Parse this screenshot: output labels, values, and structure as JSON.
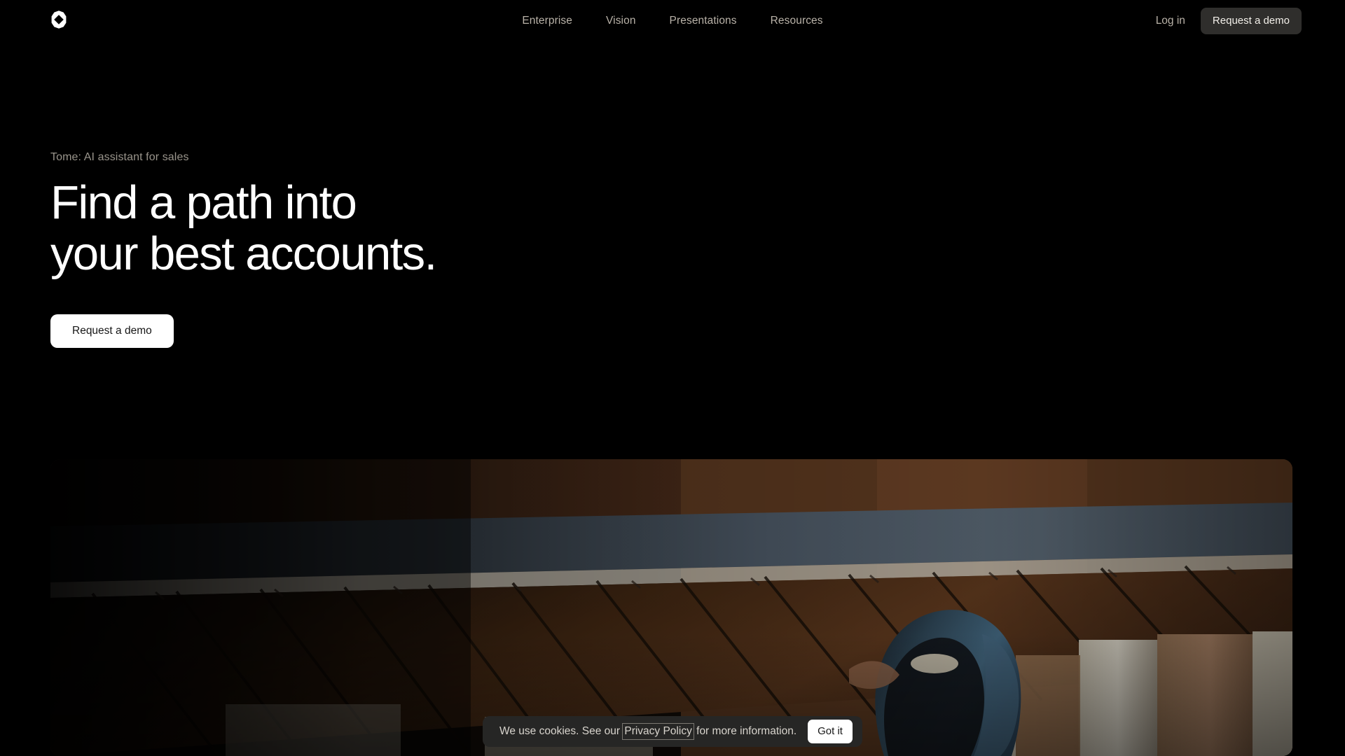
{
  "brand": {
    "logo_icon": "tome-octagon-logo",
    "logo_color": "#ffffff"
  },
  "nav": {
    "links": [
      {
        "label": "Enterprise"
      },
      {
        "label": "Vision"
      },
      {
        "label": "Presentations"
      },
      {
        "label": "Resources"
      }
    ],
    "login_label": "Log in",
    "cta_label": "Request a demo",
    "link_color": "#b9b2a8",
    "cta_bg": "#2f2e2c"
  },
  "hero": {
    "eyebrow": "Tome: AI assistant for sales",
    "title": "Find a path into\nyour best accounts.",
    "cta_label": "Request a demo",
    "title_color": "#ffffff",
    "eyebrow_color": "#99948b",
    "cta_bg": "#ffffff",
    "cta_text_color": "#161616"
  },
  "hero_media": {
    "alt": "Dark interior photograph looking up at the underside of a wooden staircase with a person in a blue jacket ascending",
    "dominant_colors": [
      "#0d0907",
      "#5b3a26",
      "#8a6a4d",
      "#4a5663",
      "#c9c2b4"
    ]
  },
  "cookie_banner": {
    "text_before": "We use cookies. See our",
    "link_label": "Privacy Policy",
    "text_after": "for more information.",
    "button_label": "Got it",
    "bg": "#262625",
    "text_color": "#d8d4cd",
    "button_bg": "#ffffff"
  },
  "page": {
    "background": "#000000"
  }
}
